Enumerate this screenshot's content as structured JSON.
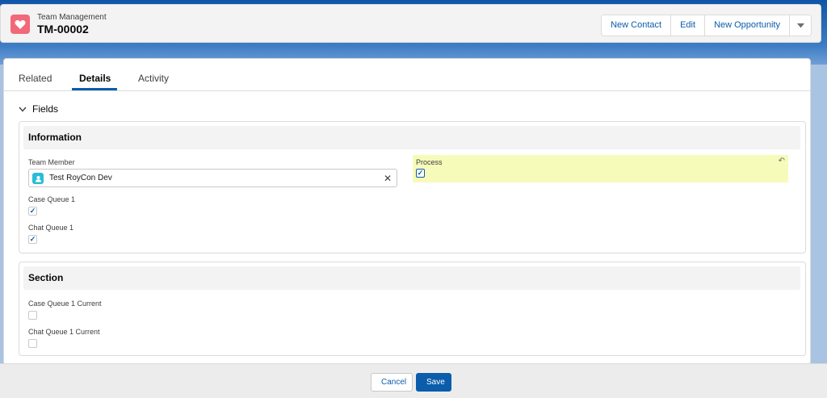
{
  "header": {
    "object_type": "Team Management",
    "record_name": "TM-00002",
    "icon": "heart-icon",
    "accent_color": "#f26979",
    "actions": [
      "New Contact",
      "Edit",
      "New Opportunity"
    ],
    "menu_icon": "chevron-down-icon"
  },
  "tabs": [
    {
      "label": "Related",
      "active": false
    },
    {
      "label": "Details",
      "active": true
    },
    {
      "label": "Activity",
      "active": false
    }
  ],
  "fields_group": {
    "label": "Fields",
    "expanded": true,
    "icon": "chevron-down-icon"
  },
  "sections": {
    "information": {
      "title": "Information",
      "team_member": {
        "label": "Team Member",
        "value": "Test RoyCon Dev",
        "icon": "user-icon"
      },
      "case_queue_1": {
        "label": "Case Queue 1",
        "checked": true
      },
      "chat_queue_1": {
        "label": "Chat Queue 1",
        "checked": true
      },
      "process": {
        "label": "Process",
        "checked": true,
        "edited": true,
        "undo_icon": "undo-icon"
      }
    },
    "section": {
      "title": "Section",
      "case_queue_1_current": {
        "label": "Case Queue 1 Current",
        "checked": false
      },
      "chat_queue_1_current": {
        "label": "Chat Queue 1 Current",
        "checked": false
      }
    }
  },
  "footer": {
    "cancel_label": "Cancel",
    "save_label": "Save"
  },
  "colors": {
    "brand": "#0b5cab",
    "edited_highlight": "#f7fbb9",
    "user_icon": "#2abcd6"
  }
}
